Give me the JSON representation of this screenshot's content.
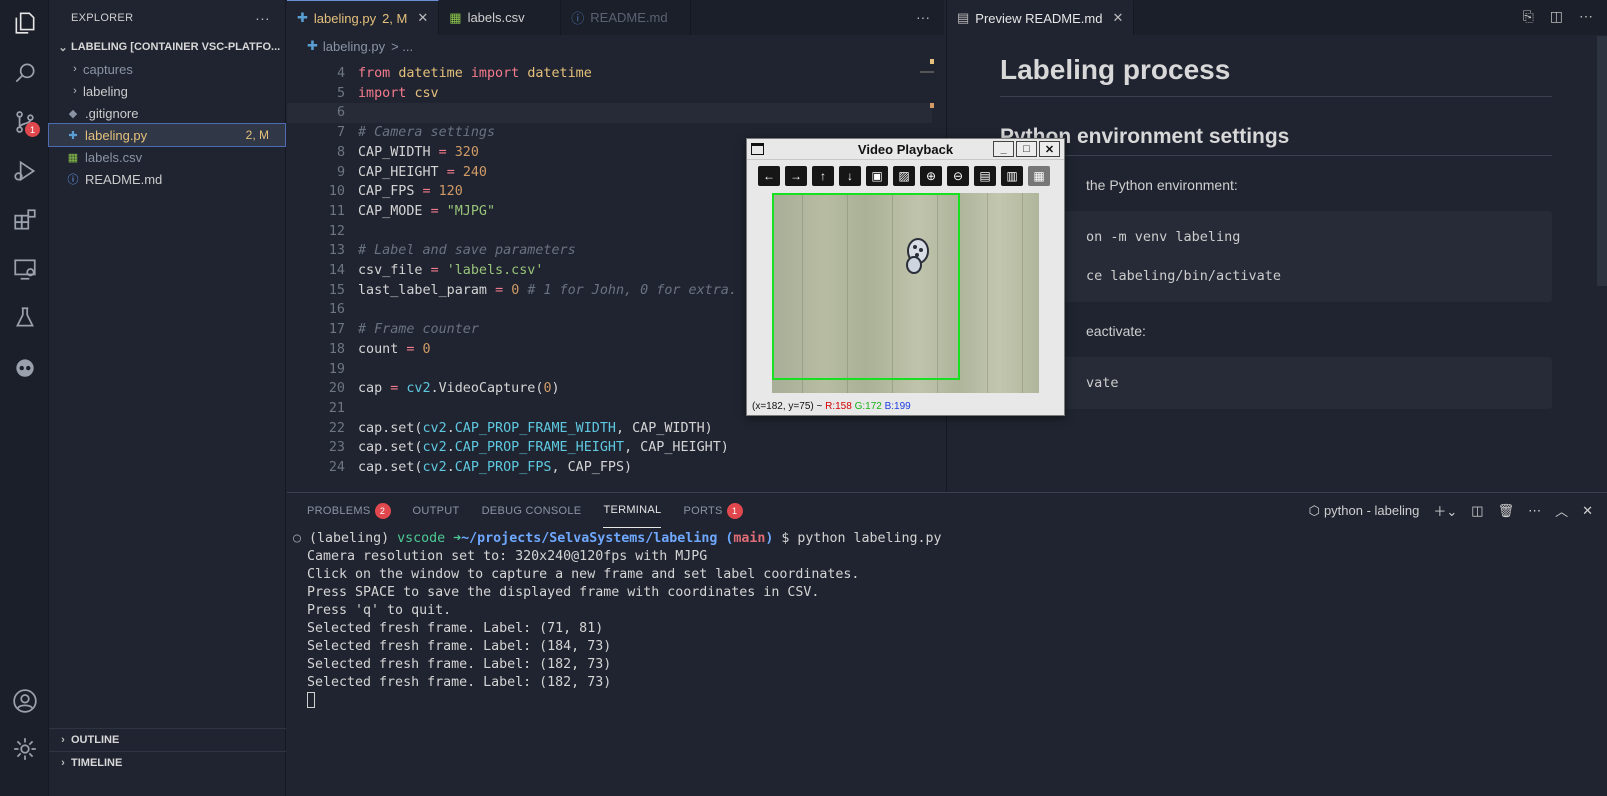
{
  "activity": {
    "scm_badge": "1"
  },
  "sidebar": {
    "title": "EXPLORER",
    "more": "···",
    "root_section": "LABELING [CONTAINER VSC-PLATFO...",
    "items": [
      {
        "label": "captures",
        "kind": "folder",
        "status": ""
      },
      {
        "label": "labeling",
        "kind": "folder",
        "status": ""
      },
      {
        "label": ".gitignore",
        "kind": "gitignore",
        "status": ""
      },
      {
        "label": "labeling.py",
        "kind": "python",
        "status": "2, M"
      },
      {
        "label": "labels.csv",
        "kind": "csv",
        "status": ""
      },
      {
        "label": "README.md",
        "kind": "info",
        "status": ""
      }
    ],
    "outline": "OUTLINE",
    "timeline": "TIMELINE"
  },
  "editor": {
    "tabs": [
      {
        "label": "labeling.py",
        "suffix": "2, M"
      },
      {
        "label": "labels.csv"
      },
      {
        "label": "README.md"
      }
    ],
    "more": "···",
    "breadcrumb": {
      "file": "labeling.py",
      "rest": "> ..."
    },
    "lines": [
      {
        "n": "4",
        "segs": [
          [
            "kw",
            "from "
          ],
          [
            "mod",
            "datetime "
          ],
          [
            "kw",
            "import "
          ],
          [
            "mod",
            "datetime"
          ]
        ]
      },
      {
        "n": "5",
        "segs": [
          [
            "kw",
            "import "
          ],
          [
            "mod",
            "csv"
          ]
        ]
      },
      {
        "n": "6",
        "segs": []
      },
      {
        "n": "7",
        "segs": [
          [
            "cmt",
            "# Camera settings"
          ]
        ]
      },
      {
        "n": "8",
        "segs": [
          [
            "",
            "CAP_WIDTH "
          ],
          [
            "op",
            "= "
          ],
          [
            "num",
            "320"
          ]
        ]
      },
      {
        "n": "9",
        "segs": [
          [
            "",
            "CAP_HEIGHT "
          ],
          [
            "op",
            "= "
          ],
          [
            "num",
            "240"
          ]
        ]
      },
      {
        "n": "10",
        "segs": [
          [
            "",
            "CAP_FPS "
          ],
          [
            "op",
            "= "
          ],
          [
            "num",
            "120"
          ]
        ]
      },
      {
        "n": "11",
        "segs": [
          [
            "",
            "CAP_MODE "
          ],
          [
            "op",
            "= "
          ],
          [
            "str",
            "\"MJPG\""
          ]
        ]
      },
      {
        "n": "12",
        "segs": []
      },
      {
        "n": "13",
        "segs": [
          [
            "cmt",
            "# Label and save parameters"
          ]
        ]
      },
      {
        "n": "14",
        "segs": [
          [
            "",
            "csv_file "
          ],
          [
            "op",
            "= "
          ],
          [
            "str",
            "'labels.csv'"
          ]
        ]
      },
      {
        "n": "15",
        "segs": [
          [
            "",
            "last_label_param "
          ],
          [
            "op",
            "= "
          ],
          [
            "num",
            "0 "
          ],
          [
            "cmt",
            "# 1 for John, 0 for extra."
          ]
        ]
      },
      {
        "n": "16",
        "segs": []
      },
      {
        "n": "17",
        "segs": [
          [
            "cmt",
            "# Frame counter"
          ]
        ]
      },
      {
        "n": "18",
        "segs": [
          [
            "",
            "count "
          ],
          [
            "op",
            "= "
          ],
          [
            "num",
            "0"
          ]
        ]
      },
      {
        "n": "19",
        "segs": []
      },
      {
        "n": "20",
        "segs": [
          [
            "",
            "cap "
          ],
          [
            "op",
            "= "
          ],
          [
            "cls",
            "cv2"
          ],
          [
            "",
            ".VideoCapture("
          ],
          [
            "num",
            "0"
          ],
          [
            "",
            ")"
          ]
        ]
      },
      {
        "n": "21",
        "segs": []
      },
      {
        "n": "22",
        "segs": [
          [
            "",
            "cap.set("
          ],
          [
            "cls",
            "cv2"
          ],
          [
            "",
            "."
          ],
          [
            "cls",
            "CAP_PROP_FRAME_WIDTH"
          ],
          [
            "",
            ", CAP_WIDTH)"
          ]
        ]
      },
      {
        "n": "23",
        "segs": [
          [
            "",
            "cap.set("
          ],
          [
            "cls",
            "cv2"
          ],
          [
            "",
            "."
          ],
          [
            "cls",
            "CAP_PROP_FRAME_HEIGHT"
          ],
          [
            "",
            ", CAP_HEIGHT)"
          ]
        ]
      },
      {
        "n": "24",
        "segs": [
          [
            "",
            "cap.set("
          ],
          [
            "cls",
            "cv2"
          ],
          [
            "",
            "."
          ],
          [
            "cls",
            "CAP_PROP_FPS"
          ],
          [
            "",
            ", CAP_FPS)"
          ]
        ]
      }
    ]
  },
  "preview": {
    "tab": "Preview README.md",
    "h1": "Labeling process",
    "h2": "Python environment settings",
    "p1": "the Python environment:",
    "code1": [
      "on -m venv labeling",
      "ce labeling/bin/activate"
    ],
    "p2": "eactivate:",
    "code2": [
      "vate"
    ]
  },
  "video_window": {
    "title": "Video Playback",
    "status_coords": "(x=182, y=75) ~",
    "r": "R:158",
    "g": "G:172",
    "b": "B:199"
  },
  "panel": {
    "tabs": [
      {
        "label": "PROBLEMS",
        "badge": "2"
      },
      {
        "label": "OUTPUT",
        "badge": ""
      },
      {
        "label": "DEBUG CONSOLE",
        "badge": ""
      },
      {
        "label": "TERMINAL",
        "badge": ""
      },
      {
        "label": "PORTS",
        "badge": "1"
      }
    ],
    "terminal_name": "python - labeling",
    "prompt": {
      "env": "(labeling) ",
      "user": "vscode ",
      "arrow": "➜",
      "path": "~/projects/SelvaSystems/labeling ",
      "branch_open": "(",
      "branch": "main",
      "branch_close": ")",
      "cmd": " $ python labeling.py"
    },
    "output": [
      "Camera resolution set to: 320x240@120fps with MJPG",
      "Click on the window to capture a new frame and set label coordinates.",
      "Press SPACE to save the displayed frame with coordinates in CSV.",
      "Press 'q' to quit.",
      "Selected fresh frame. Label: (71, 81)",
      "Selected fresh frame. Label: (184, 73)",
      "Selected fresh frame. Label: (182, 73)",
      "Selected fresh frame. Label: (182, 73)"
    ]
  }
}
